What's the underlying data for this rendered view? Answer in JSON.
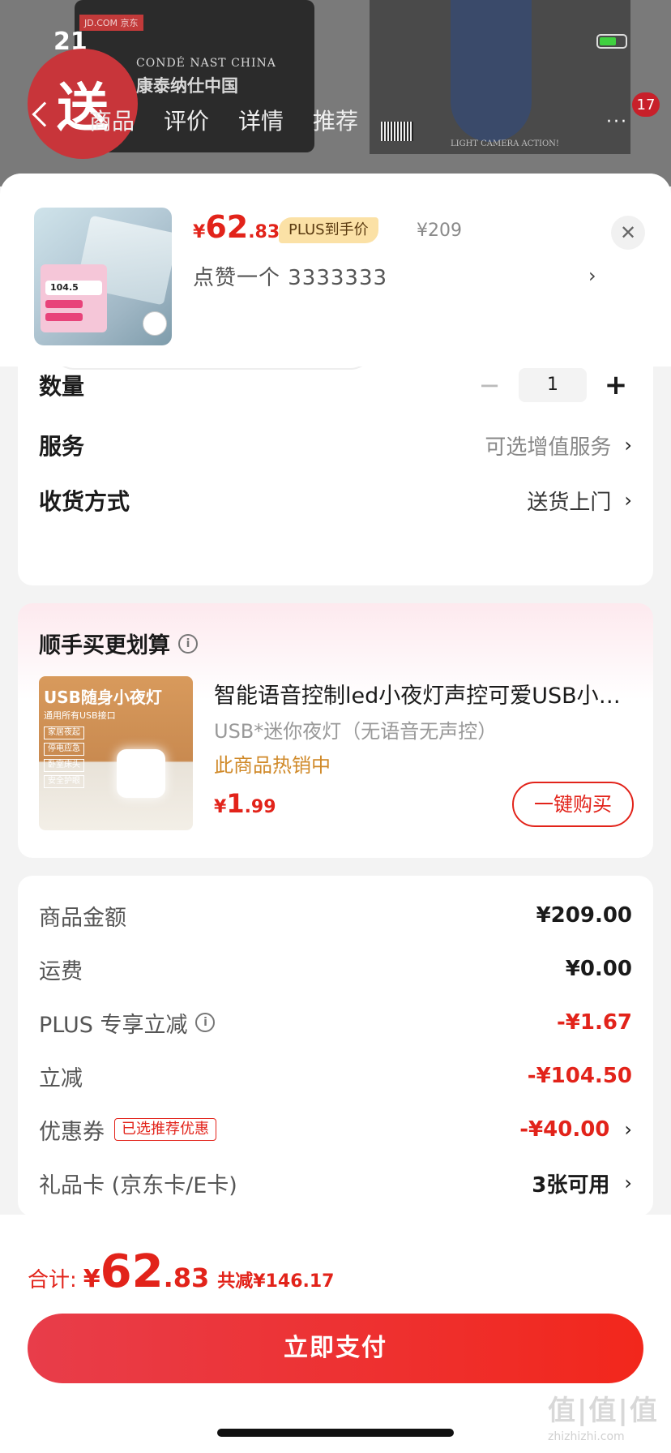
{
  "background": {
    "time": "21",
    "badge": "送",
    "book_brand": "JD.COM 京东",
    "book_line1": "CONDÉ NAST CHINA",
    "book_line2": "康泰纳仕中国",
    "photo_caption": "LIGHT CAMERA ACTION!",
    "tabs": [
      "商品",
      "评价",
      "详情",
      "推荐"
    ],
    "cart_count": "17"
  },
  "product": {
    "currency": "¥",
    "price_int": "62",
    "price_dec": ".83",
    "plus_tag": "PLUS到手价",
    "original_price": "¥209",
    "variant": "点赞一个  3333333",
    "thumb_price": "104.5"
  },
  "options": {
    "quantity_label": "数量",
    "quantity_value": "1",
    "service_label": "服务",
    "service_value": "可选增值服务",
    "delivery_label": "收货方式",
    "delivery_value": "送货上门"
  },
  "upsell": {
    "title": "顺手买更划算",
    "image_title": "USB随身小夜灯",
    "image_sub": "通用所有USB接口",
    "image_tags": [
      "家居夜起",
      "停电应急",
      "卧室床头",
      "安全护眼"
    ],
    "name": "智能语音控制led小夜灯声控可爱USB小夜灯",
    "sub": "USB*迷你夜灯（无语音无声控）",
    "hot": "此商品热销中",
    "currency": "¥",
    "price_int": "1",
    "price_dec": ".99",
    "buy_label": "一键购买"
  },
  "costs": {
    "items": [
      {
        "label": "商品金额",
        "value": "¥209.00"
      },
      {
        "label": "运费",
        "value": "¥0.00"
      },
      {
        "label": "PLUS 专享立减",
        "value": "-¥1.67"
      },
      {
        "label": "立减",
        "value": "-¥104.50"
      },
      {
        "label": "优惠券",
        "tag": "已选推荐优惠",
        "value": "-¥40.00"
      },
      {
        "label": "礼品卡 (京东卡/E卡)",
        "value": "3张可用"
      }
    ]
  },
  "footer": {
    "total_label": "合计:",
    "currency": "¥",
    "total_int": "62",
    "total_dec": ".83",
    "saved": "共减¥146.17",
    "pay_label": "立即支付",
    "watermark": "值|值|值",
    "watermark_sub": "zhizhizhi.com"
  },
  "colors": {
    "accent_red": "#e2231a",
    "plus_gold": "#fbe1a6",
    "hot_orange": "#d08a2a"
  }
}
